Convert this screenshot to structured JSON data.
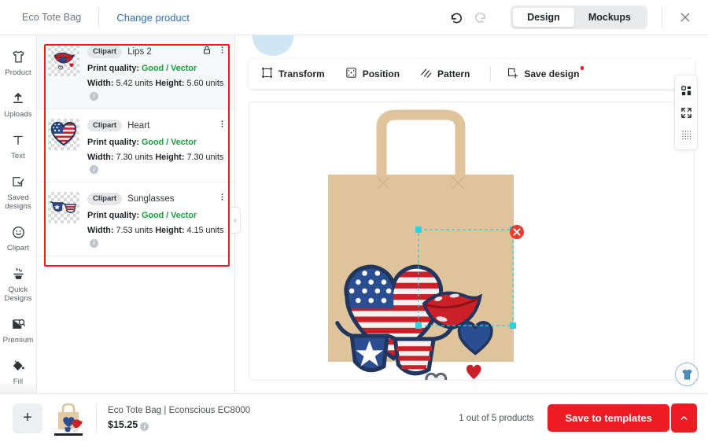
{
  "topbar": {
    "product_title": "Eco Tote Bag",
    "change_product": "Change product",
    "undo_icon": "undo-icon",
    "redo_icon": "redo-icon",
    "view_modes": [
      {
        "label": "Design",
        "active": true
      },
      {
        "label": "Mockups",
        "active": false
      }
    ],
    "close_icon": "close-icon"
  },
  "sidebar": {
    "items": [
      {
        "label": "Product",
        "icon": "tshirt-icon"
      },
      {
        "label": "Uploads",
        "icon": "upload-icon"
      },
      {
        "label": "Text",
        "icon": "text-icon"
      },
      {
        "label": "Saved designs",
        "icon": "saved-designs-icon"
      },
      {
        "label": "Clipart",
        "icon": "smiley-icon"
      },
      {
        "label": "Quick Designs",
        "icon": "quick-designs-icon"
      },
      {
        "label": "Premium",
        "icon": "premium-image-icon"
      },
      {
        "label": "Fill",
        "icon": "paint-bucket-icon"
      }
    ]
  },
  "layers": {
    "highlight_color": "#ee1b24",
    "quality_color": "#15a03c",
    "labels": {
      "badge": "Clipart",
      "print_quality": "Print quality:",
      "width": "Width:",
      "height": "Height:",
      "units": "units"
    },
    "items": [
      {
        "name": "Lips 2",
        "badge": "Clipart",
        "quality": "Good / Vector",
        "width": "5.42",
        "height": "5.60",
        "locked": true,
        "selected": true
      },
      {
        "name": "Heart",
        "badge": "Clipart",
        "quality": "Good / Vector",
        "width": "7.30",
        "height": "7.30",
        "locked": false,
        "selected": false
      },
      {
        "name": "Sunglasses",
        "badge": "Clipart",
        "quality": "Good / Vector",
        "width": "7.53",
        "height": "4.15",
        "locked": false,
        "selected": false
      }
    ]
  },
  "toolbar": {
    "transform": "Transform",
    "position": "Position",
    "pattern": "Pattern",
    "save_design": "Save design",
    "save_design_modified": true
  },
  "canvas": {
    "product_color": "#dfc39b",
    "selection_color": "#2fd0e0",
    "delete_icon": "delete-selection-icon",
    "right_tools": [
      {
        "icon": "layout-grid-icon"
      },
      {
        "icon": "expand-fullscreen-icon"
      },
      {
        "icon": "dotted-grid-icon"
      }
    ],
    "fab_icon": "tshirt-preview-icon"
  },
  "bottom": {
    "add_icon": "add-product-icon",
    "add_label": "+",
    "product_name": "Eco Tote Bag | Econscious EC8000",
    "product_price": "$15.25",
    "product_count": "1 out of 5 products",
    "save_button": "Save to templates",
    "save_caret_icon": "chevron-up-icon"
  }
}
